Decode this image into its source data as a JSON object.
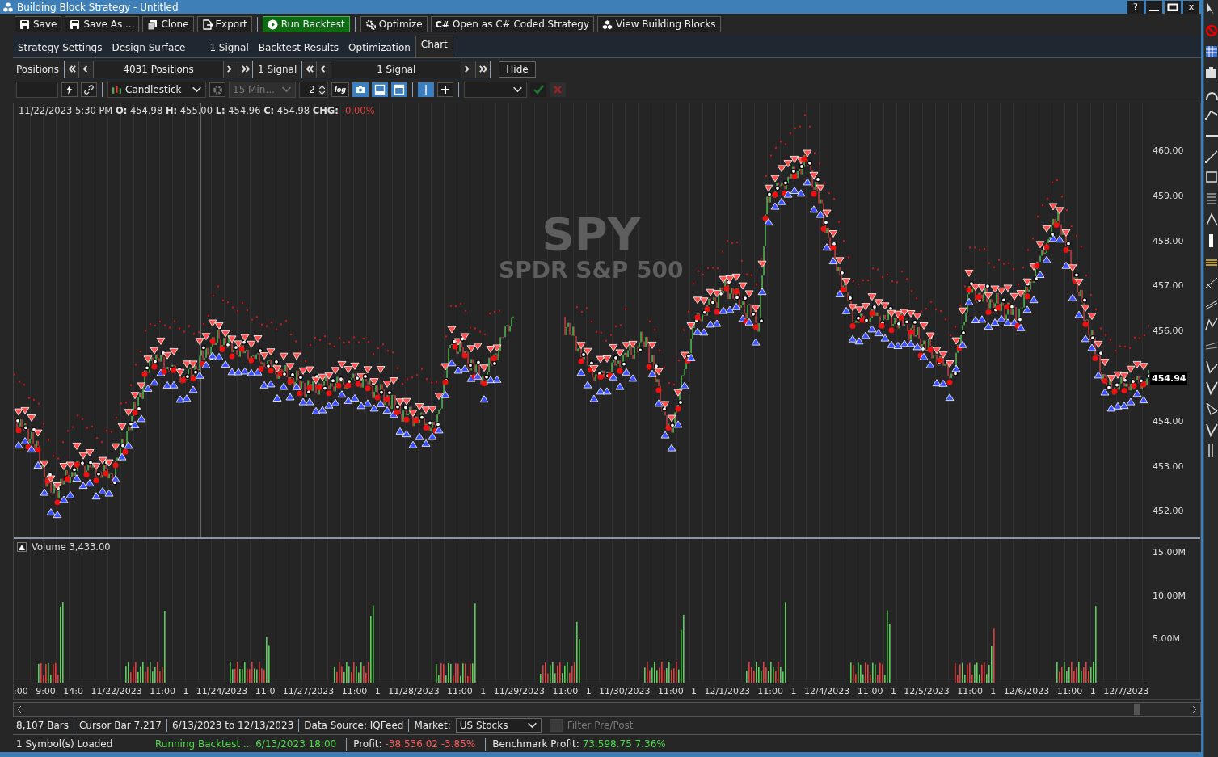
{
  "window": {
    "title": "Building Block Strategy - Untitled",
    "help": "?",
    "close": "x"
  },
  "toolbar": [
    {
      "label": "Save",
      "kind": "save"
    },
    {
      "label": "Save As ...",
      "kind": "save"
    },
    {
      "label": "Clone",
      "kind": "clone"
    },
    {
      "label": "Export",
      "kind": "export"
    },
    {
      "label": "Run Backtest",
      "kind": "run"
    },
    {
      "label": "Optimize",
      "kind": "optimize"
    },
    {
      "label": "Open as C# Coded Strategy",
      "kind": "code",
      "icon_text": "C#"
    },
    {
      "label": "View Building Blocks",
      "kind": "blocks"
    }
  ],
  "tabs": [
    {
      "label": "Strategy Settings",
      "selected": false
    },
    {
      "label": "Design Surface",
      "selected": false
    },
    {
      "label": "1 Signal",
      "selected": false
    },
    {
      "label": "Backtest Results",
      "selected": false
    },
    {
      "label": "Optimization",
      "selected": false
    },
    {
      "label": "Chart",
      "selected": true
    }
  ],
  "positions_bar": {
    "label": "Positions",
    "positions": "4031 Positions",
    "signal_label": "1 Signal",
    "signal": "1 Signal",
    "hide": "Hide"
  },
  "chart_toolbar": {
    "chart_type": "Candlestick",
    "interval": {
      "value": "15 Min...",
      "disabled": true
    },
    "spinner": "2",
    "log": "log",
    "toggles": [
      {
        "kind": "camera",
        "selected": true
      },
      {
        "kind": "pane-bottom",
        "selected": true
      },
      {
        "kind": "pane-top",
        "selected": true
      },
      {
        "kind": "cursor",
        "selected": true
      },
      {
        "kind": "plus",
        "selected": false
      }
    ]
  },
  "chart": {
    "header": "11/22/2023 5:30 PM **O:** 454.98 **H:** 455.00 **L:** 454.96 **C:** 454.98 **CHG:**",
    "change": "-0.00%",
    "watermark": {
      "symbol": "SPY",
      "name": "SPDR S&P 500"
    },
    "price_ticks": [
      "460.00",
      "459.00",
      "458.00",
      "457.00",
      "456.00",
      "454.00",
      "453.00",
      "452.00"
    ],
    "last_price": "454.94",
    "volume_label": "Volume 3,433.00",
    "volume_ticks": [
      "15.00M",
      "10.00M",
      "5.00M"
    ],
    "time_labels": [
      ":00",
      "9:00",
      "14:0",
      "11/22/2023",
      "11:00",
      "1",
      "11/24/2023",
      "11:0",
      "11/27/2023",
      "11:00",
      "1",
      "11/28/2023",
      "11:00",
      "1",
      "11/29/2023",
      "11:00",
      "1",
      "11/30/2023",
      "11:00",
      "1",
      "12/1/2023",
      "11:00",
      "1",
      "12/4/2023",
      "11:00",
      "1",
      "12/5/2023",
      "11:00",
      "1",
      "12/6/2023",
      "11:00",
      "1",
      "12/7/2023"
    ]
  },
  "status_bar": {
    "items": [
      "8,107 Bars",
      "Cursor Bar 7,217",
      "6/13/2023 to 12/13/2023",
      "Data Source: IQFeed"
    ],
    "market_label": "Market:",
    "market": "US Stocks",
    "filter": {
      "label": "Filter Pre/Post",
      "checked": false,
      "disabled": true
    }
  },
  "footer": [
    {
      "parts": [
        {
          "text": "1 Symbol(s) Loaded",
          "kind": "plain"
        }
      ]
    },
    {
      "parts": [
        {
          "text": "Running Backtest ... 6/13/2023 18:00",
          "kind": "positive"
        }
      ]
    },
    {
      "parts": [
        {
          "text": "Profit:",
          "kind": "plain"
        },
        {
          "text": "-38,536.02 -3.85%",
          "kind": "negative"
        }
      ]
    },
    {
      "parts": [
        {
          "text": "Benchmark Profit:",
          "kind": "plain"
        },
        {
          "text": "73,598.75 7.36%",
          "kind": "positive"
        }
      ]
    }
  ]
}
